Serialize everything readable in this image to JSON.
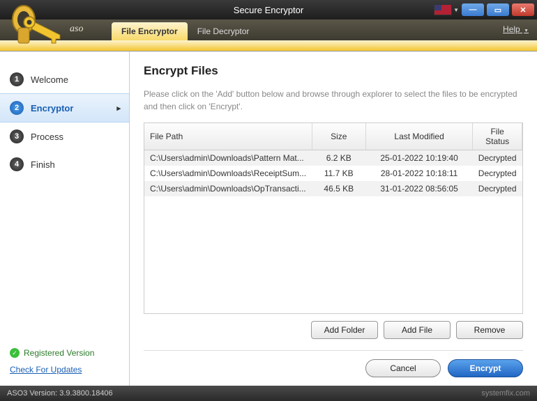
{
  "titlebar": {
    "title": "Secure Encryptor"
  },
  "menu": {
    "brand": "aso",
    "tabs": [
      {
        "label": "File Encryptor",
        "active": true
      },
      {
        "label": "File Decryptor",
        "active": false
      }
    ],
    "help": "Help"
  },
  "sidebar": {
    "steps": [
      {
        "num": "1",
        "label": "Welcome"
      },
      {
        "num": "2",
        "label": "Encryptor"
      },
      {
        "num": "3",
        "label": "Process"
      },
      {
        "num": "4",
        "label": "Finish"
      }
    ],
    "registered": "Registered Version",
    "check_updates": "Check For Updates"
  },
  "content": {
    "heading": "Encrypt Files",
    "description": "Please click on the 'Add' button below and browse through explorer to select the files to be encrypted and then click on 'Encrypt'."
  },
  "table": {
    "headers": {
      "path": "File Path",
      "size": "Size",
      "modified": "Last Modified",
      "status": "File Status"
    },
    "rows": [
      {
        "path": "C:\\Users\\admin\\Downloads\\Pattern Mat...",
        "size": "6.2 KB",
        "modified": "25-01-2022 10:19:40",
        "status": "Decrypted"
      },
      {
        "path": "C:\\Users\\admin\\Downloads\\ReceiptSum...",
        "size": "11.7 KB",
        "modified": "28-01-2022 10:18:11",
        "status": "Decrypted"
      },
      {
        "path": "C:\\Users\\admin\\Downloads\\OpTransacti...",
        "size": "46.5 KB",
        "modified": "31-01-2022 08:56:05",
        "status": "Decrypted"
      }
    ]
  },
  "buttons": {
    "add_folder": "Add Folder",
    "add_file": "Add File",
    "remove": "Remove",
    "cancel": "Cancel",
    "encrypt": "Encrypt"
  },
  "statusbar": {
    "version": "ASO3 Version: 3.9.3800.18406",
    "watermark": "systemfix.com"
  }
}
